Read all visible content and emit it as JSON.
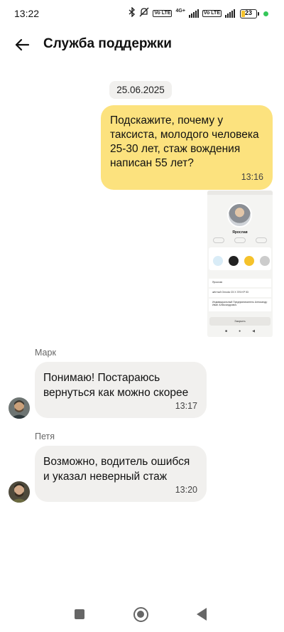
{
  "status_bar": {
    "time": "13:22",
    "net_label": "4G+",
    "sim_badge_1": "Vo LTE",
    "sim_badge_2": "Vo LTE",
    "battery_level": "23",
    "icons": [
      "bluetooth-icon",
      "mute-icon",
      "signal-icon",
      "battery-icon"
    ]
  },
  "header": {
    "title": "Служба поддержки",
    "back_icon": "arrow-left-icon"
  },
  "chat": {
    "date": "25.06.2025",
    "messages": [
      {
        "direction": "out",
        "text": "Подскажите, почему у таксиста, молодого человека 25-30 лет, стаж вождения написан 55 лет?",
        "time": "13:16"
      },
      {
        "direction": "in",
        "sender": "Марк",
        "text": "Понимаю! Постараюсь вернуться как можно скорее",
        "time": "13:17"
      },
      {
        "direction": "in",
        "sender": "Петя",
        "text": "Возможно, водитель ошибся и указал неверный стаж",
        "time": "13:20"
      }
    ],
    "attachment": {
      "driver_name": "Ярослав",
      "row_1": "Ярослав",
      "row_2": "жёлтый Omoda C5 X 376 KP 53",
      "row_3": "Индивидуальный Предприниматель Александр Иван Александрович",
      "close_label": "Закрыть",
      "badge_colors": [
        "#d9ecf7",
        "#222222",
        "#f5c22b",
        "#cccccc"
      ]
    }
  },
  "navbar": {
    "icons": [
      "recents-square-icon",
      "home-circle-icon",
      "back-triangle-icon"
    ]
  }
}
